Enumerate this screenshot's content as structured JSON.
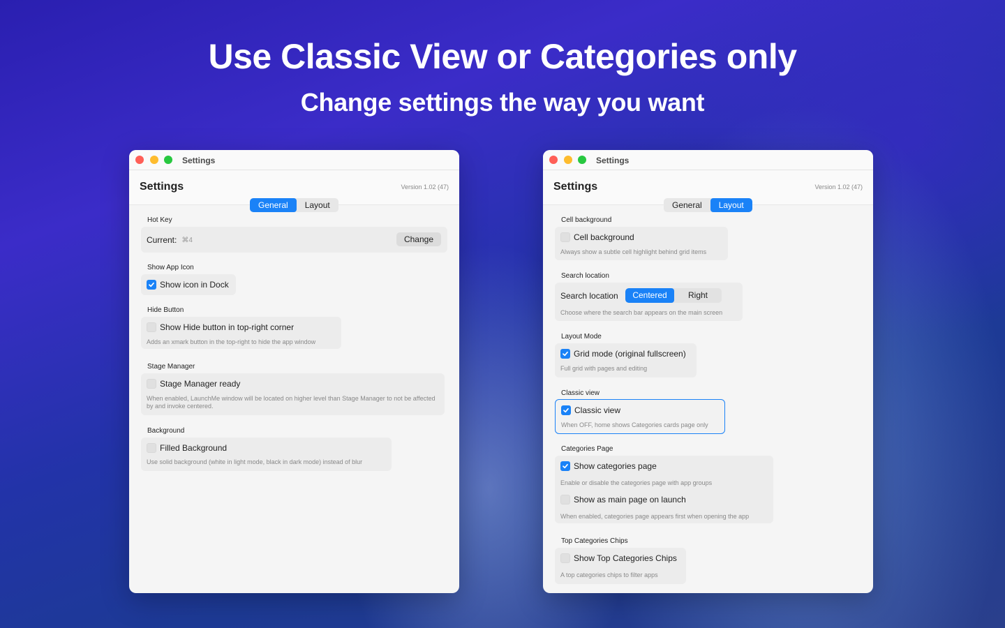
{
  "hero": {
    "title": "Use Classic View or Categories only",
    "subtitle": "Change settings the way you want"
  },
  "colors": {
    "accent": "#1a82f7",
    "window_bg": "#f5f5f5"
  },
  "left_window": {
    "titlebar": "Settings",
    "header_title": "Settings",
    "version": "Version 1.02 (47)",
    "tabs": [
      {
        "label": "General",
        "active": true
      },
      {
        "label": "Layout",
        "active": false
      }
    ],
    "hotkey": {
      "section": "Hot Key",
      "current_label": "Current:",
      "current_value": "⌘4",
      "change_label": "Change"
    },
    "app_icon": {
      "section": "Show App Icon",
      "label": "Show icon in Dock",
      "checked": true
    },
    "hide_button": {
      "section": "Hide Button",
      "label": "Show Hide button in top-right corner",
      "checked": false,
      "hint": "Adds an xmark button in the top-right to hide the app window"
    },
    "stage_manager": {
      "section": "Stage Manager",
      "label": "Stage Manager ready",
      "checked": false,
      "hint": "When enabled, LaunchMe window will be located on higher level than Stage Manager to not be affected by and invoke centered."
    },
    "background": {
      "section": "Background",
      "label": "Filled Background",
      "checked": false,
      "hint": "Use solid background (white in light mode, black in dark mode) instead of blur"
    }
  },
  "right_window": {
    "titlebar": "Settings",
    "header_title": "Settings",
    "version": "Version 1.02 (47)",
    "tabs": [
      {
        "label": "General",
        "active": false
      },
      {
        "label": "Layout",
        "active": true
      }
    ],
    "cell_background": {
      "section": "Cell background",
      "label": "Cell background",
      "checked": false,
      "hint": "Always show a subtle cell highlight behind grid items"
    },
    "search_location": {
      "section": "Search location",
      "label": "Search location",
      "options": [
        "Centered",
        "Right"
      ],
      "selected": "Centered",
      "hint": "Choose where the search bar appears on the main screen"
    },
    "layout_mode": {
      "section": "Layout Mode",
      "label": "Grid mode (original fullscreen)",
      "checked": true,
      "hint": "Full grid with pages and editing"
    },
    "classic_view": {
      "section": "Classic view",
      "label": "Classic view",
      "checked": true,
      "hint": "When OFF, home shows Categories cards page only"
    },
    "categories_page": {
      "section": "Categories Page",
      "show_label": "Show categories page",
      "show_checked": true,
      "show_hint": "Enable or disable the categories page with app groups",
      "main_label": "Show as main page on launch",
      "main_checked": false,
      "main_hint": "When enabled, categories page appears first when opening the app"
    },
    "top_chips": {
      "section": "Top Categories Chips",
      "label": "Show Top Categories Chips",
      "checked": false,
      "hint": "A top categories chips to filter apps"
    }
  }
}
